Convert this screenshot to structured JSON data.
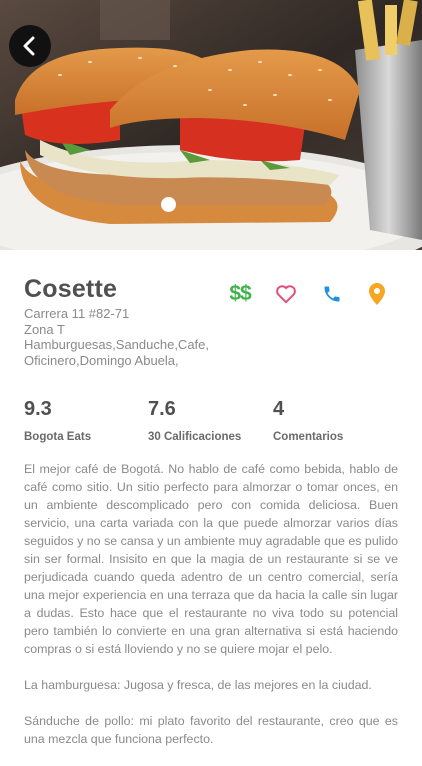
{
  "restaurant": {
    "name": "Cosette",
    "price_level": "$$",
    "address": "Carrera 11 #82-71",
    "zone": "Zona T",
    "categories": "Hamburguesas,Sanduche,Cafe,",
    "tags": "Oficinero,Domingo Abuela,"
  },
  "actions": {
    "favorite_icon": "heart-outline",
    "call_icon": "phone",
    "map_icon": "map-pin"
  },
  "stats": [
    {
      "value": "9.3",
      "label": "Bogota Eats"
    },
    {
      "value": "7.6",
      "label": "30 Calificaciones"
    },
    {
      "value": "4",
      "label": "Comentarios"
    }
  ],
  "review": [
    "El mejor café de Bogotá. No hablo de café como bebida, hablo de café como sitio. Un sitio perfecto para almorzar o tomar onces, en un ambiente descomplicado pero con comida deliciosa. Buen servicio, una carta variada con la que puede almorzar varios días seguidos y no se cansa y un ambiente muy agradable que es pulido sin ser formal. Insisito en que la magia de un restaurante si se ve perjudicada cuando queda adentro de un centro comercial, sería una mejor experiencia en una terraza que da hacia la calle sin lugar a dudas. Esto hace que el restaurante no viva todo su potencial pero también lo convierte en una gran alternativa si está haciendo compras o si está lloviendo y no se quiere mojar el pelo.",
    "La hamburguesa: Jugosa y fresca, de las mejores en la ciudad.",
    "Sánduche de pollo: mi plato favorito del restaurante, creo que es una mezcla que funciona perfecto."
  ],
  "colors": {
    "price": "#3fb34a",
    "heart": "#e0507a",
    "phone": "#1f8fe0",
    "pin": "#f5a623",
    "back_button": "#111111"
  }
}
